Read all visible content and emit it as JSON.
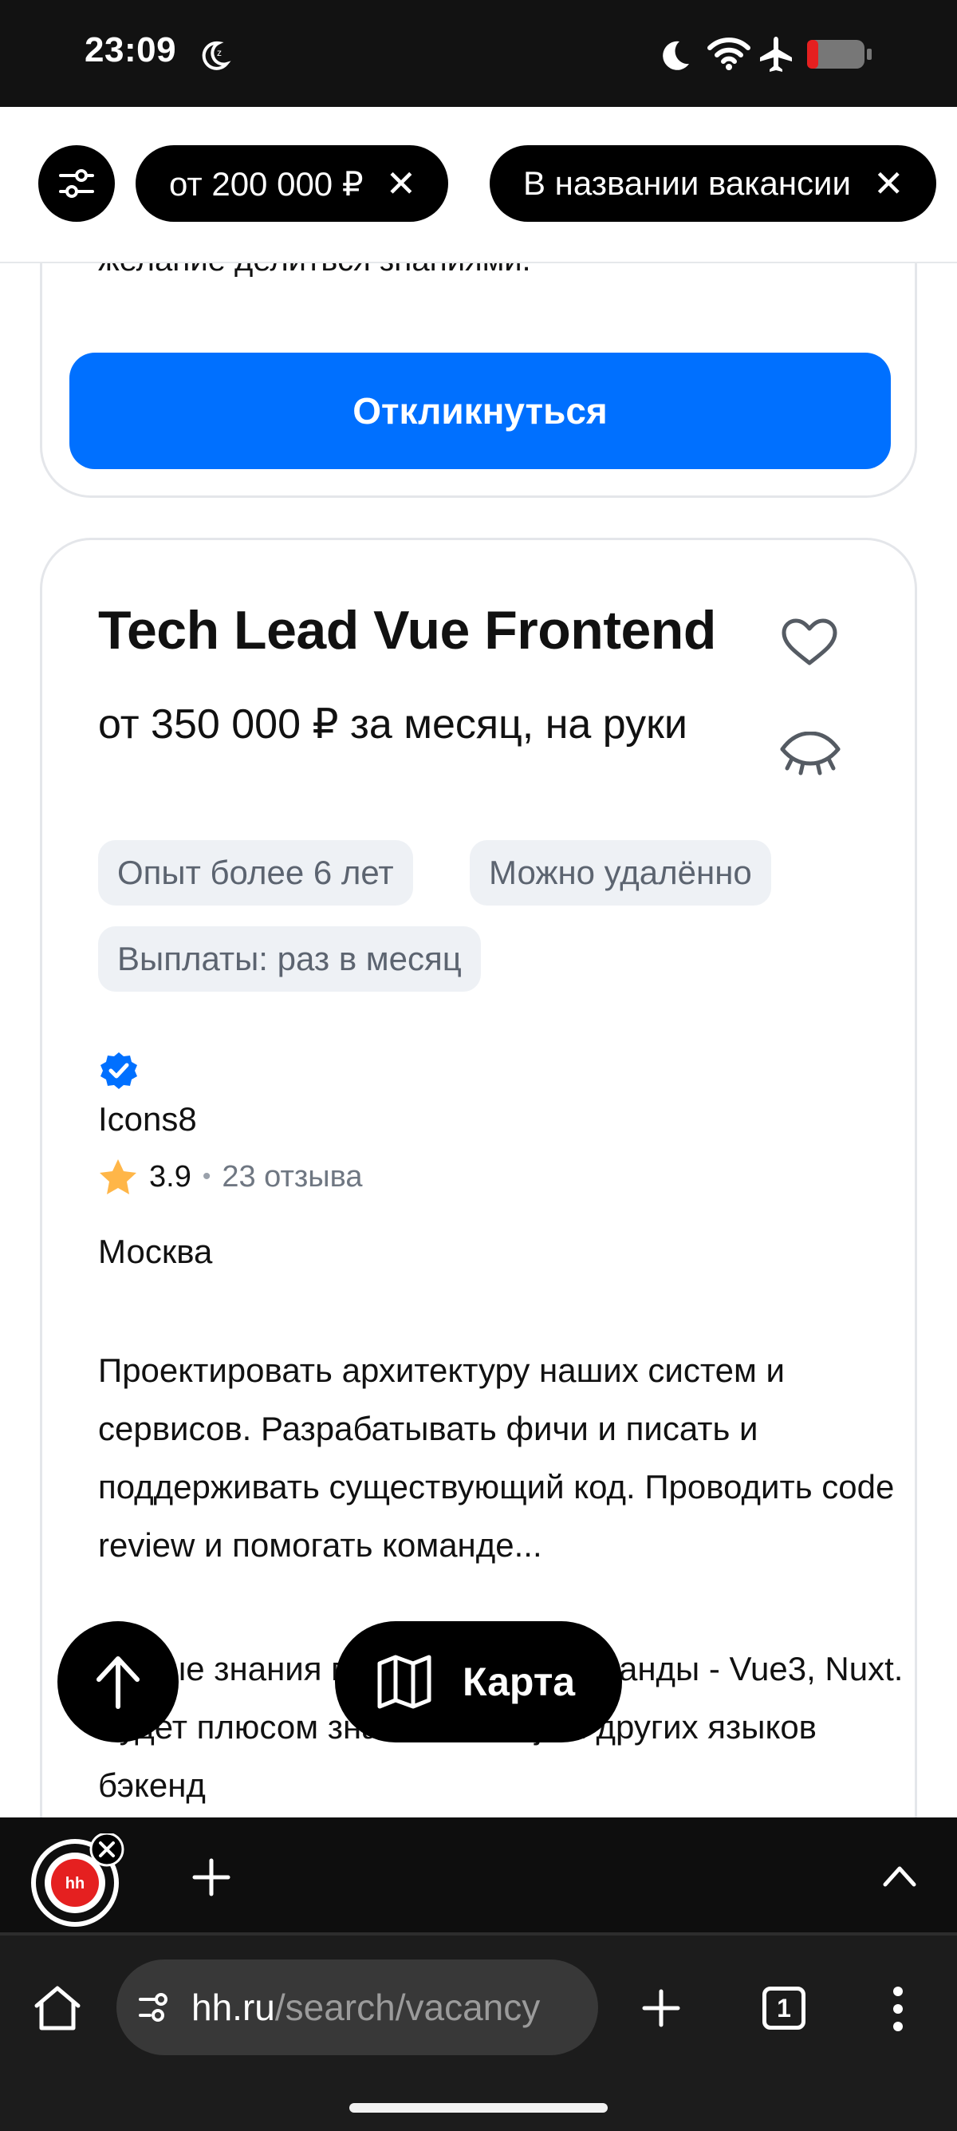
{
  "status_bar": {
    "time": "23:09"
  },
  "filters": {
    "chips": [
      {
        "label": "от 200 000 ₽"
      },
      {
        "label": "В названии вакансии"
      }
    ]
  },
  "card_previous": {
    "tail_text": "желание делиться знаниями.",
    "apply_label": "Откликнуться"
  },
  "vacancy": {
    "title": "Tech Lead Vue Frontend",
    "salary": "от 350 000 ₽ за месяц, на руки",
    "tags": [
      "Опыт более 6 лет",
      "Можно удалённо",
      "Выплаты: раз в месяц"
    ],
    "company": "Icons8",
    "rating": "3.9",
    "reviews": "23 отзыва",
    "city": "Москва",
    "description_1": "Проектировать архитектуру наших систем и сервисов. Разрабатывать фичи и писать и поддерживать существующий код. Проводить code review и помогать команде...",
    "description_2": "...ьные знания в стеке нашей команды - Vue3, Nuxt. Будет плюсом знание Node.js и других языков бэкенд"
  },
  "fab": {
    "map_label": "Карта"
  },
  "browser": {
    "url_host": "hh.ru",
    "url_path": "/search/vacancy",
    "tab_count": "1",
    "app_icon_text": "hh"
  },
  "colors": {
    "accent": "#0070ff",
    "star": "#ffb648",
    "verified": "#0070ff"
  }
}
